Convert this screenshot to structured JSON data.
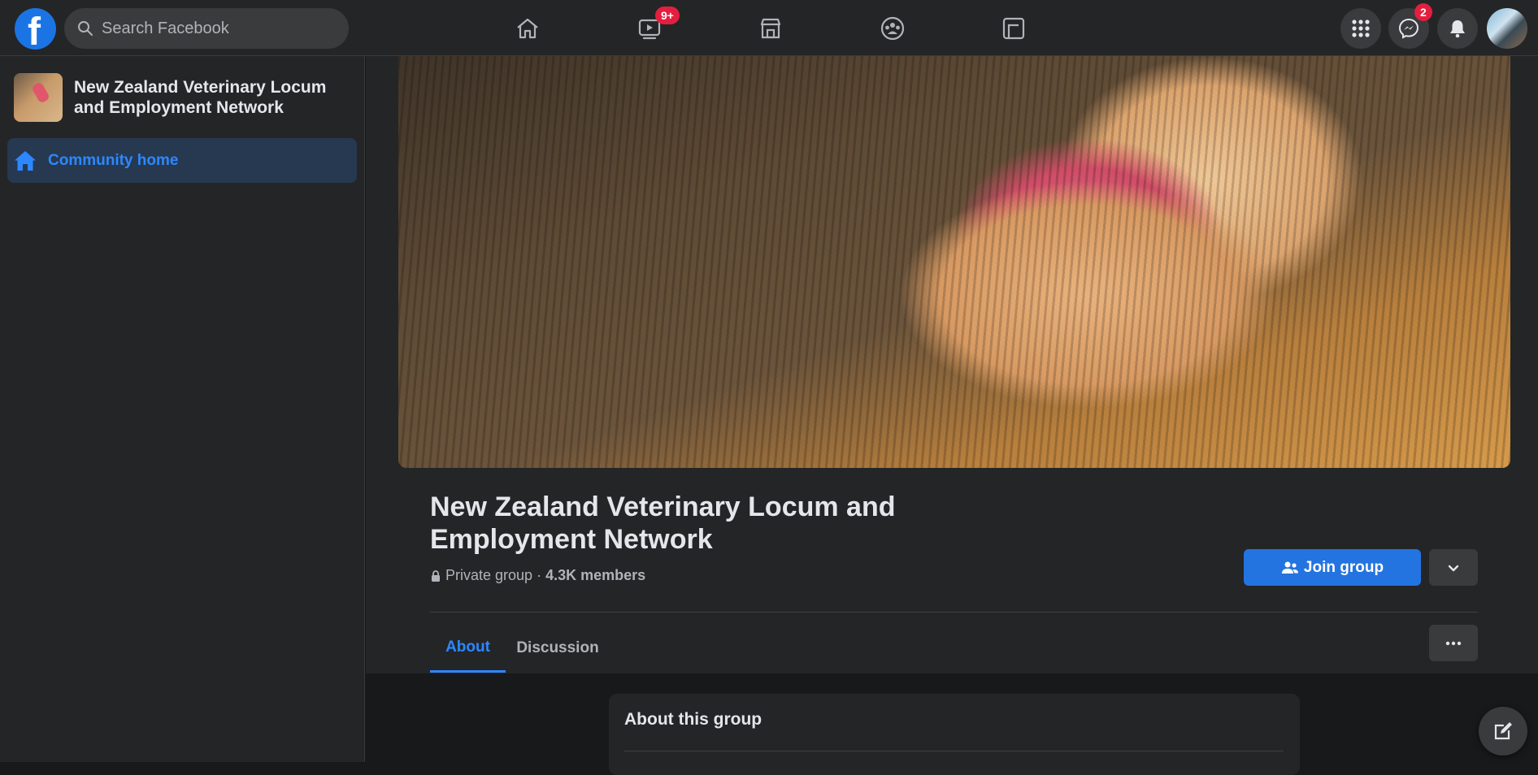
{
  "topbar": {
    "logo_letter": "f",
    "search_placeholder": "Search Facebook",
    "watch_badge": "9+",
    "messenger_badge": "2"
  },
  "sidebar": {
    "group_name": "New Zealand Veterinary Locum and Employment Network",
    "nav_item": "Community home"
  },
  "group": {
    "title": "New Zealand Veterinary Locum and Employment Network",
    "privacy": "Private group",
    "separator": " · ",
    "members": "4.3K members",
    "join_label": "Join group"
  },
  "tabs": [
    {
      "label": "About",
      "active": true
    },
    {
      "label": "Discussion",
      "active": false
    }
  ],
  "about": {
    "title": "About this group"
  },
  "colors": {
    "accent": "#2d88ff",
    "button": "#2374e1",
    "badge": "#e41e3f",
    "surface": "#242526",
    "background": "#18191a"
  }
}
